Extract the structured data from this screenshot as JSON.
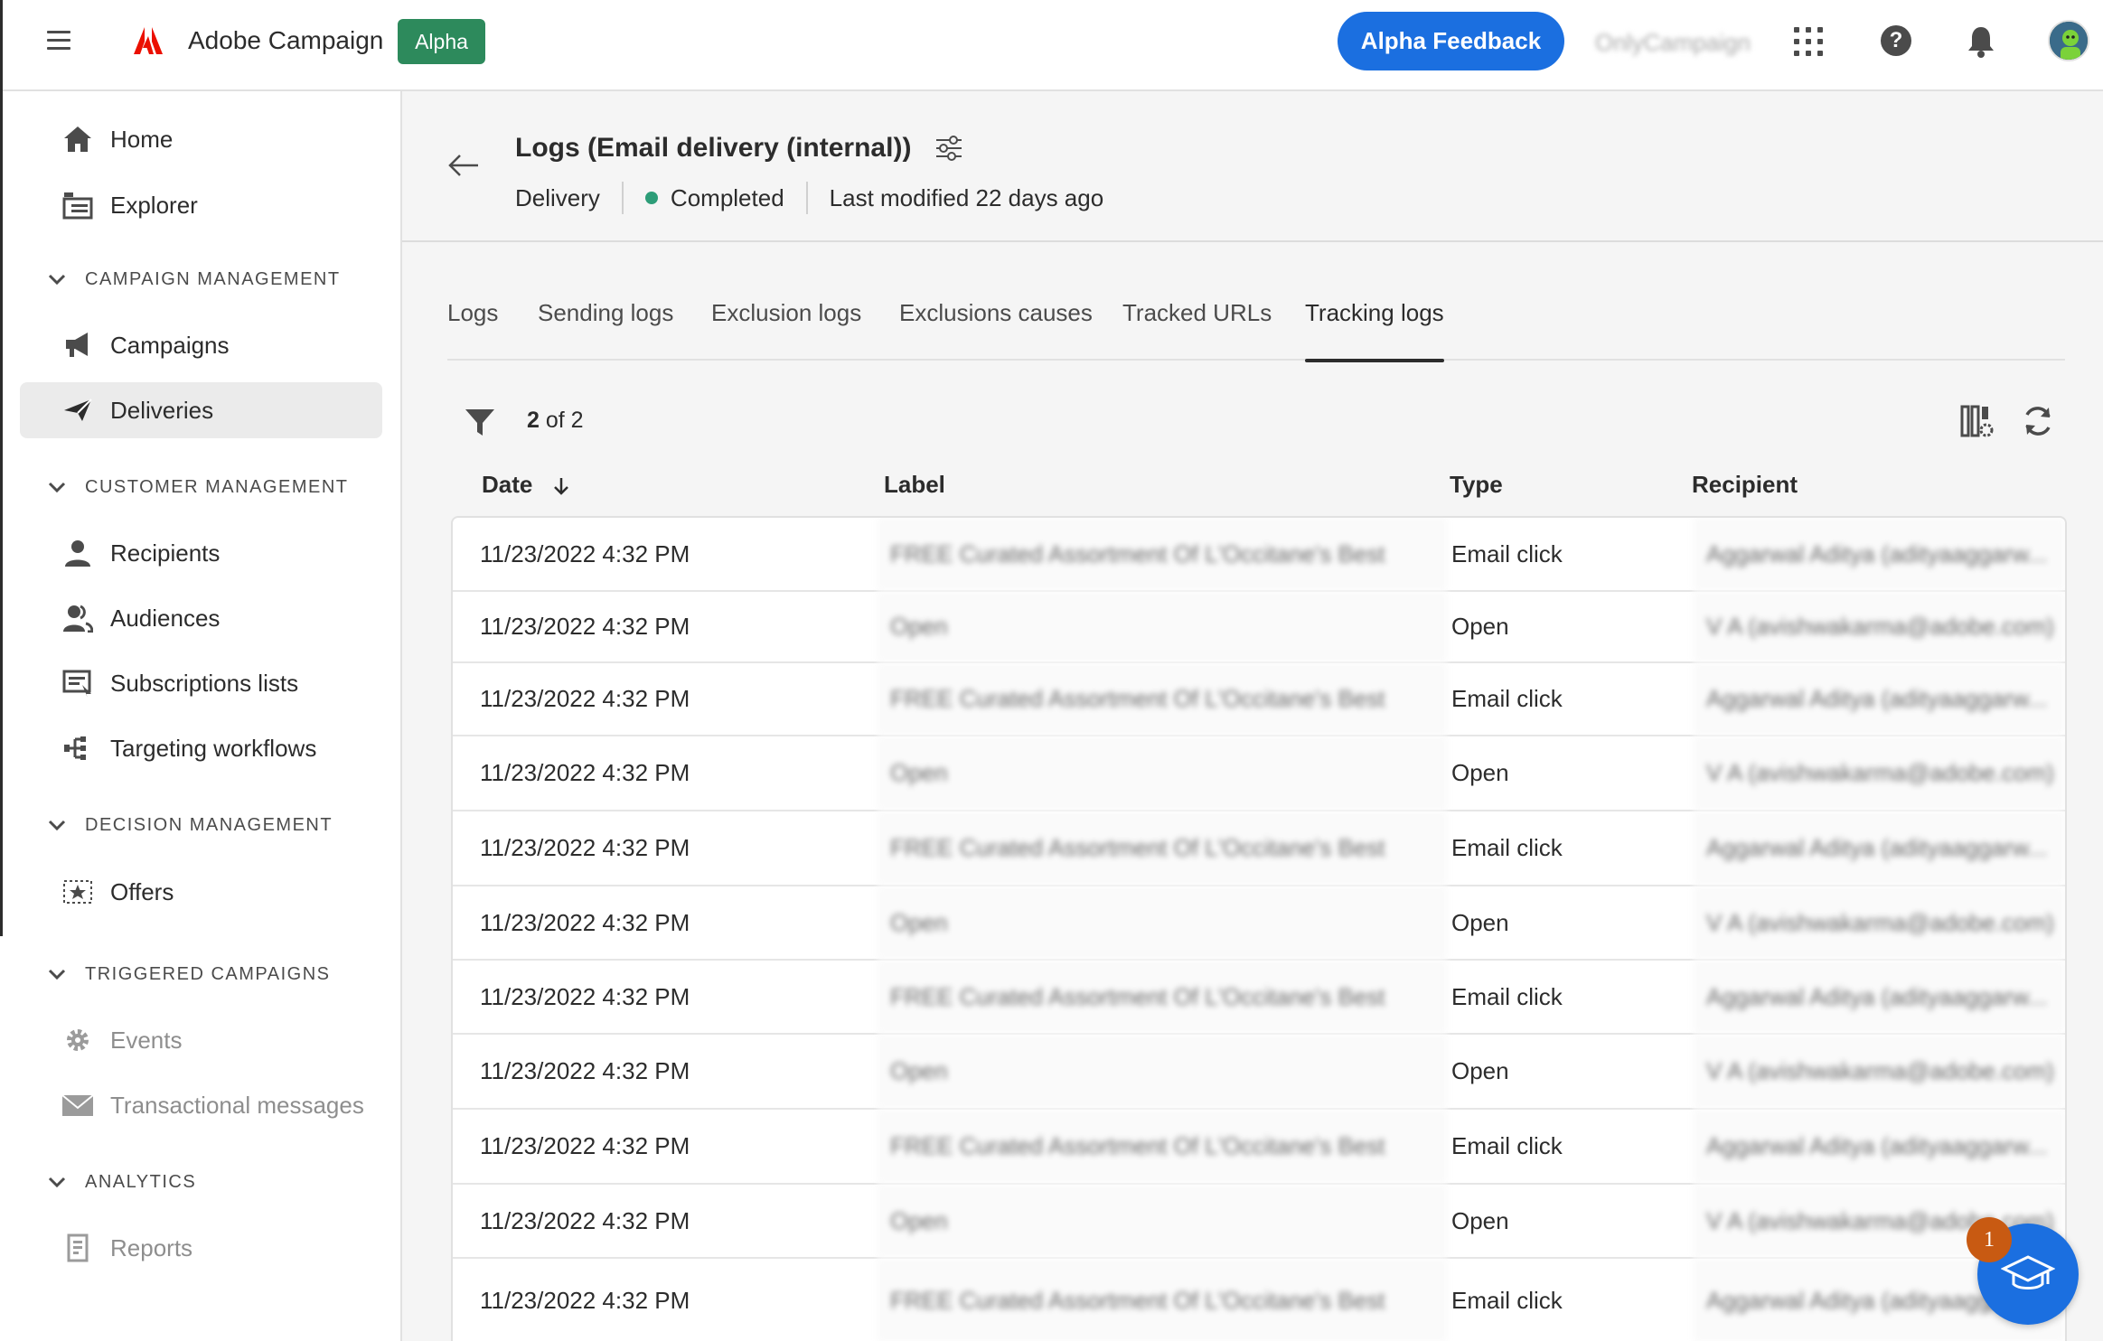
{
  "topbar": {
    "app_name": "Adobe Campaign",
    "alpha_badge": "Alpha",
    "feedback_label": "Alpha Feedback",
    "org_name": "OnlyCampaign",
    "colors": {
      "brand_red": "#eb1000",
      "feedback_blue": "#1b6fe0",
      "alpha_green": "#2d8a5c"
    }
  },
  "sidebar": {
    "items": [
      {
        "label": "Home",
        "icon": "home-icon"
      },
      {
        "label": "Explorer",
        "icon": "explorer-icon"
      },
      {
        "label": "Campaigns",
        "icon": "megaphone-icon"
      },
      {
        "label": "Deliveries",
        "icon": "send-icon"
      },
      {
        "label": "Recipients",
        "icon": "user-icon"
      },
      {
        "label": "Audiences",
        "icon": "users-icon"
      },
      {
        "label": "Subscriptions lists",
        "icon": "list-icon"
      },
      {
        "label": "Targeting workflows",
        "icon": "workflow-icon"
      },
      {
        "label": "Offers",
        "icon": "offer-icon"
      },
      {
        "label": "Events",
        "icon": "gear-icon"
      },
      {
        "label": "Transactional messages",
        "icon": "mail-icon"
      },
      {
        "label": "Reports",
        "icon": "report-icon"
      }
    ],
    "sections": [
      "CAMPAIGN MANAGEMENT",
      "CUSTOMER MANAGEMENT",
      "DECISION MANAGEMENT",
      "TRIGGERED CAMPAIGNS",
      "ANALYTICS"
    ],
    "active_item": "Deliveries"
  },
  "header": {
    "title": "Logs (Email delivery (internal))",
    "type": "Delivery",
    "status": "Completed",
    "last_modified": "Last modified 22 days ago"
  },
  "tabs": [
    {
      "label": "Logs"
    },
    {
      "label": "Sending logs"
    },
    {
      "label": "Exclusion logs"
    },
    {
      "label": "Exclusions causes"
    },
    {
      "label": "Tracked URLs"
    },
    {
      "label": "Tracking logs"
    }
  ],
  "selected_tab": "Tracking logs",
  "toolbar": {
    "count_current": "2",
    "count_text": "of 2"
  },
  "table": {
    "columns": [
      "Date",
      "Label",
      "Type",
      "Recipient"
    ],
    "rows": [
      {
        "date": "11/23/2022 4:32 PM",
        "label": "FREE Curated Assortment Of L'Occitane's Best",
        "type": "Email click",
        "recipient": "Aggarwal Aditya (adityaaggarw..."
      },
      {
        "date": "11/23/2022 4:32 PM",
        "label": "Open",
        "type": "Open",
        "recipient": "V A (avishwakarma@adobe.com)"
      },
      {
        "date": "11/23/2022 4:32 PM",
        "label": "FREE Curated Assortment Of L'Occitane's Best",
        "type": "Email click",
        "recipient": "Aggarwal Aditya (adityaaggarw..."
      },
      {
        "date": "11/23/2022 4:32 PM",
        "label": "Open",
        "type": "Open",
        "recipient": "V A (avishwakarma@adobe.com)"
      },
      {
        "date": "11/23/2022 4:32 PM",
        "label": "FREE Curated Assortment Of L'Occitane's Best",
        "type": "Email click",
        "recipient": "Aggarwal Aditya (adityaaggarw..."
      },
      {
        "date": "11/23/2022 4:32 PM",
        "label": "Open",
        "type": "Open",
        "recipient": "V A (avishwakarma@adobe.com)"
      },
      {
        "date": "11/23/2022 4:32 PM",
        "label": "FREE Curated Assortment Of L'Occitane's Best",
        "type": "Email click",
        "recipient": "Aggarwal Aditya (adityaaggarw..."
      },
      {
        "date": "11/23/2022 4:32 PM",
        "label": "Open",
        "type": "Open",
        "recipient": "V A (avishwakarma@adobe.com)"
      },
      {
        "date": "11/23/2022 4:32 PM",
        "label": "FREE Curated Assortment Of L'Occitane's Best",
        "type": "Email click",
        "recipient": "Aggarwal Aditya (adityaaggarw..."
      },
      {
        "date": "11/23/2022 4:32 PM",
        "label": "Open",
        "type": "Open",
        "recipient": "V A (avishwakarma@adobe.com)"
      },
      {
        "date": "11/23/2022 4:32 PM",
        "label": "FREE Curated Assortment Of L'Occitane's Best",
        "type": "Email click",
        "recipient": "Aggarwal Aditya (adityaaggarw..."
      }
    ]
  },
  "learn": {
    "badge_count": "1"
  }
}
